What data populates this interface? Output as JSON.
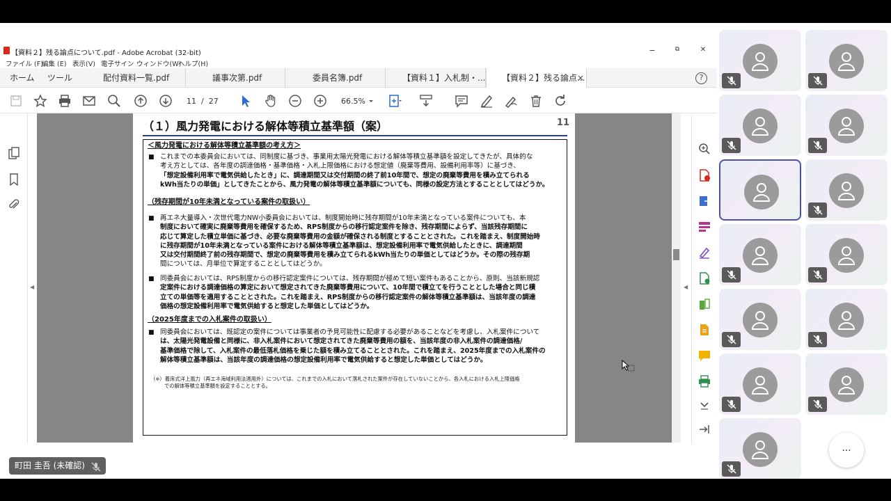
{
  "window": {
    "title": "【資料２】残る論点について.pdf - Adobe Acrobat (32-bit)",
    "minimize": "−",
    "restore": "⧉",
    "close": "✕"
  },
  "menu": [
    "ファイル (F)",
    "編集 (E)",
    "表示(V)",
    "電子サイン",
    "ウィンドウ(W)",
    "ヘルプ(H)"
  ],
  "tabs": {
    "home": "ホーム",
    "tools": "ツール",
    "docs": [
      "配付資料一覧.pdf",
      "議事次第.pdf",
      "委員名簿.pdf",
      "【資料１】入札制・..."
    ],
    "active": "【資料２】残る論点...",
    "close": "×",
    "help": "?"
  },
  "toolbar": {
    "page_current": "11",
    "page_sep": "/",
    "page_total": "27",
    "zoom": "66.5%"
  },
  "slide": {
    "title": "（１）風力発電における解体等積立基準額（案）",
    "page_number": "11",
    "h1": "＜風力発電における解体等積立基準額の考え方＞",
    "p1_l1": "これまでの本委員会においては、同制度に基づき、事業用太陽光発電における解体等積立基準額を設定してきたが、具体的な",
    "p1_l2": "考え方としては、各年度の調達価格・基準価格・入札上限価格における想定値（廃棄等費用、設備利用率等）に基づき、",
    "p1_l3": "「想定設備利用率で電気供給したとき」に、調達期間又は交付期間の終了前10年間で、想定の廃棄等費用を積み立てられる",
    "p1_l4": "kWh当たりの単価」としてきたことから、風力発電の解体等積立基準額についても、同様の設定方法とすることとしてはどうか。",
    "h2": "（残存期間が10年未満となっている案件の取扱い）",
    "p2_l1": "再エネ大量導入・次世代電力NW小委員会においては、制度開始時に残存期間が10年未満となっている案件についても、本",
    "p2_l2": "制度において確実に廃棄等費用を確保するため、RPS制度からの移行認定案件を除き、残存期間によらず、当該残存期間に",
    "p2_l3": "応じて算定した積立単価に基づき、必要な廃棄等費用の金額が確保される制度とすることとされた。これを踏まえ、制度開始時",
    "p2_l4": "に残存期間が10年未満となっている案件における解体等積立基準額は、想定設備利用率で電気供給したときに、調達期間",
    "p2_l5": "又は交付期間終了前の残存期間で、想定の廃棄等費用を積み立てられるkWh当たりの単価としてはどうか。その際の残存期",
    "p2_l6": "間については、月単位で算定することとしてはどうか。",
    "p3_l1": "同委員会においては、RPS制度からの移行認定案件については、残存期間が極めて短い案件もあることから、原則、当該新規認",
    "p3_l2": "定案件における調達価格の算定において想定されてきた廃棄等費用について、10年間で積立てを行うこととした場合と同じ積",
    "p3_l3": "立ての単価等を適用することとされた。これを踏まえ、RPS制度からの移行認定案件の解体等積立基準額は、当該年度の調達",
    "p3_l4": "価格の想定設備利用率で電気供給すると想定した単価としてはどうか。",
    "h3": "（2025年度までの入札案件の取扱い）",
    "p4_l1": "同委員会においては、既認定の案件については事業者の予見可能性に配慮する必要があることなどを考慮し、入札案件について",
    "p4_l2": "は、太陽光発電設備と同様に、非入札案件において想定されてきた廃棄等費用の額を、当該年度の非入札案件の調達価格/",
    "p4_l3": "基準価格で除して、入札案件の最低落札価格を乗じた額を積み立てることとされた。これを踏まえ、2025年度までの入札案件の",
    "p4_l4": "解体等積立基準額は、当該年度の調達価格の想定設備利用率で電気供給すると想定した単価としてはどうか。",
    "note_l1": "（※）着床式洋上風力（再エネ海域利用法適用外）については、これまでの入札において落札された案件が存在していないことから、各入札における入札上限価格",
    "note_l2": "での解体等積立基準額を設定することとする。",
    "bullet": "■"
  },
  "presenter": {
    "name": "町田 圭吾 (未確認)"
  },
  "participants": {
    "count": 13,
    "selected_index": 4,
    "more": "..."
  }
}
